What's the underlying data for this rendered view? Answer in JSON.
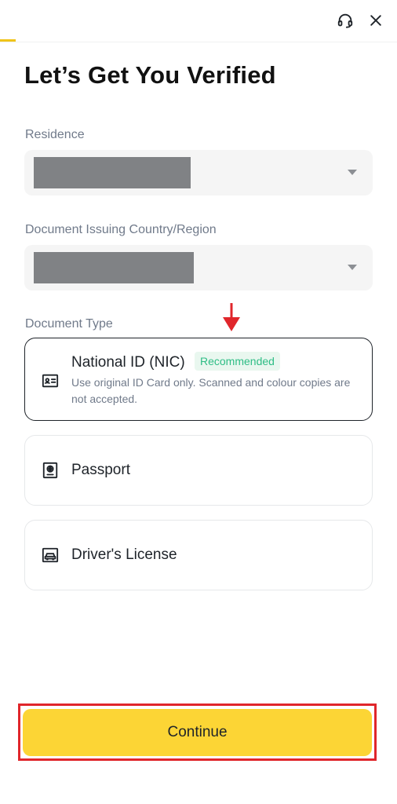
{
  "header": {
    "progress_fraction": 0.04,
    "support_icon": "headset-icon",
    "close_icon": "close-icon"
  },
  "title": "Let’s Get You Verified",
  "residence": {
    "label": "Residence",
    "value": ""
  },
  "issuing_country": {
    "label": "Document Issuing Country/Region",
    "value": ""
  },
  "document_type": {
    "label": "Document Type",
    "options": [
      {
        "name": "National ID (NIC)",
        "badge": "Recommended",
        "description": "Use original ID Card only. Scanned and colour copies are not accepted.",
        "icon": "id-card-icon",
        "selected": true
      },
      {
        "name": "Passport",
        "icon": "passport-icon",
        "selected": false
      },
      {
        "name": "Driver's License",
        "icon": "car-license-icon",
        "selected": false
      }
    ]
  },
  "continue_label": "Continue",
  "colors": {
    "accent_yellow": "#fcd535",
    "badge_green": "#2ebd85",
    "annotation_red": "#e0262b"
  }
}
